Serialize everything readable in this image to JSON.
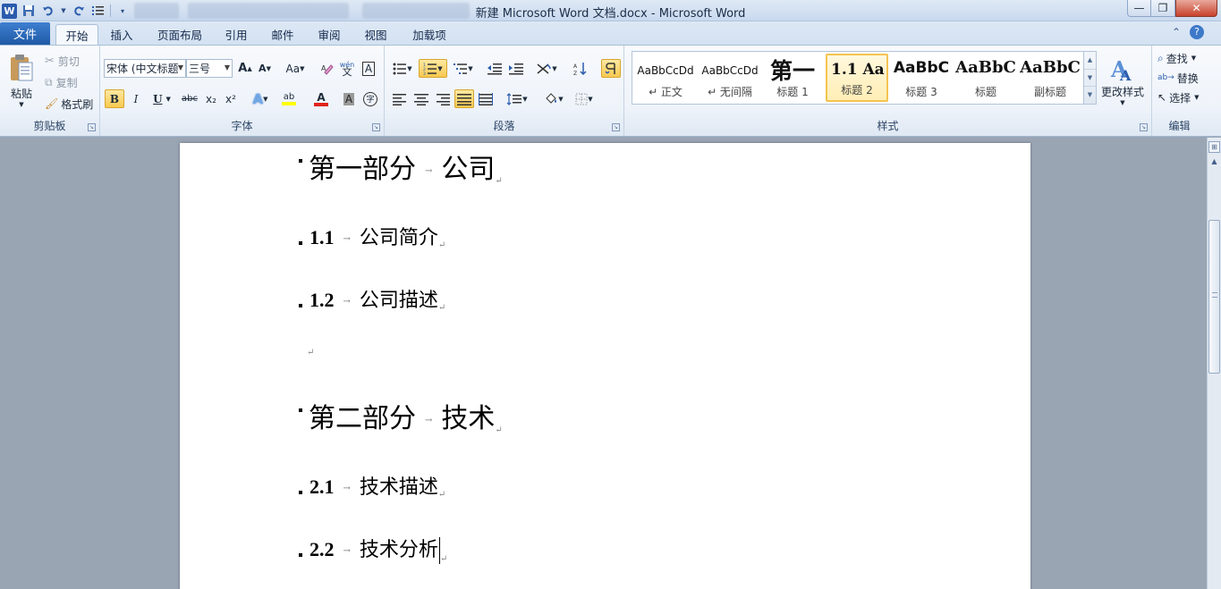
{
  "window": {
    "title": "新建 Microsoft Word 文档.docx  -  Microsoft Word",
    "logo": "W",
    "controls": {
      "minimize": "—",
      "maximize": "❐",
      "close": "✕"
    }
  },
  "quick_access": {
    "save_icon": "save-icon",
    "undo_icon": "undo-icon",
    "redo_icon": "redo-icon",
    "customize_icon": "numbering-icon"
  },
  "tabs": [
    {
      "label": "文件"
    },
    {
      "label": "开始"
    },
    {
      "label": "插入"
    },
    {
      "label": "页面布局"
    },
    {
      "label": "引用"
    },
    {
      "label": "邮件"
    },
    {
      "label": "审阅"
    },
    {
      "label": "视图"
    },
    {
      "label": "加载项"
    }
  ],
  "ribbon": {
    "clipboard": {
      "label": "剪贴板",
      "paste": "粘贴",
      "cut": "剪切",
      "copy": "复制",
      "format_painter": "格式刷"
    },
    "font": {
      "label": "字体",
      "font_name": "宋体 (中文标题",
      "font_size": "三号",
      "grow": "A",
      "shrink": "A",
      "change_case": "Aa",
      "bold": "B",
      "italic": "I",
      "underline": "U",
      "strike": "abc",
      "subscript": "x₂",
      "superscript": "x²",
      "highlight": "ab",
      "font_color": "A",
      "shading": "A",
      "enclose": "字",
      "phonetic": "wén",
      "border_char": "A"
    },
    "paragraph": {
      "label": "段落"
    },
    "styles": {
      "label": "样式",
      "change_styles": "更改样式",
      "items": [
        {
          "preview": "AaBbCcDd",
          "name": "↵ 正文"
        },
        {
          "preview": "AaBbCcDd",
          "name": "↵ 无间隔"
        },
        {
          "preview": "第一",
          "name": "标题 1"
        },
        {
          "preview": "1.1  Aa",
          "name": "标题 2"
        },
        {
          "preview": "AaBbC",
          "name": "标题 3"
        },
        {
          "preview": "AaBbC",
          "name": "标题"
        },
        {
          "preview": "AaBbC",
          "name": "副标题"
        }
      ]
    },
    "editing": {
      "label": "编辑",
      "find": "查找",
      "replace": "替换",
      "select": "选择"
    }
  },
  "document": {
    "lines": [
      {
        "number": "",
        "text": "第一部分",
        "title": "公司"
      },
      {
        "number": "1.1",
        "text": "",
        "title": "公司简介"
      },
      {
        "number": "1.2",
        "text": "",
        "title": "公司描述"
      },
      {
        "number": "",
        "text": "",
        "title": ""
      },
      {
        "number": "",
        "text": "第二部分",
        "title": "技术"
      },
      {
        "number": "2.1",
        "text": "",
        "title": "技术描述"
      },
      {
        "number": "2.2",
        "text": "",
        "title": "技术分析"
      }
    ],
    "tab_mark": "→",
    "para_mark": "↵"
  }
}
